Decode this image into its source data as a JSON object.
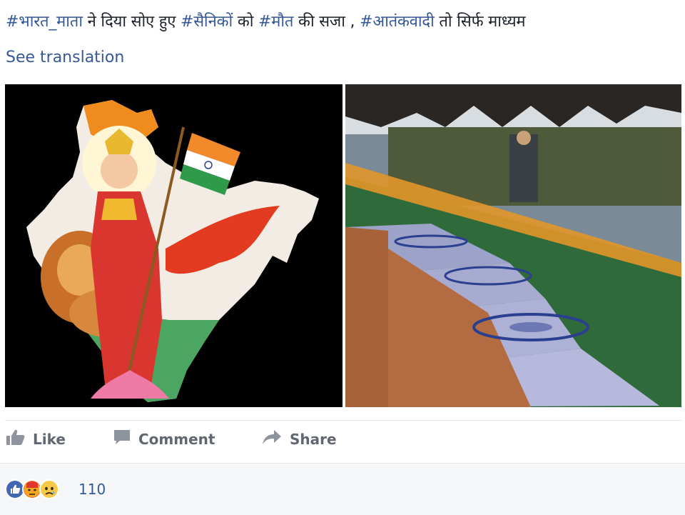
{
  "post": {
    "text_parts": [
      {
        "text": "#भारत_माता",
        "hashtag": true
      },
      {
        "text": " ने दिया सोए हुए ",
        "hashtag": false
      },
      {
        "text": "#सैनिकों",
        "hashtag": true
      },
      {
        "text": " को ",
        "hashtag": false
      },
      {
        "text": "#मौत",
        "hashtag": true
      },
      {
        "text": " की सजा , ",
        "hashtag": false
      },
      {
        "text": "#आतंकवादी",
        "hashtag": true
      },
      {
        "text": " तो सिर्फ माध्यम",
        "hashtag": false
      }
    ],
    "see_translation": "See translation"
  },
  "photos": {
    "left": {
      "subject": "goddess-with-lion-on-india-map"
    },
    "right": {
      "subject": "flag-draped-coffins-with-soldiers"
    }
  },
  "actions": {
    "like_label": "Like",
    "comment_label": "Comment",
    "share_label": "Share"
  },
  "reactions": {
    "types": [
      "like-icon",
      "angry-icon",
      "sad-icon"
    ],
    "count": "110"
  },
  "colors": {
    "hashtag": "#365899",
    "text": "#1d2129",
    "action": "#606770",
    "like_blue": "#4267b2",
    "reaction_bar_bg": "#f6f7f9"
  }
}
